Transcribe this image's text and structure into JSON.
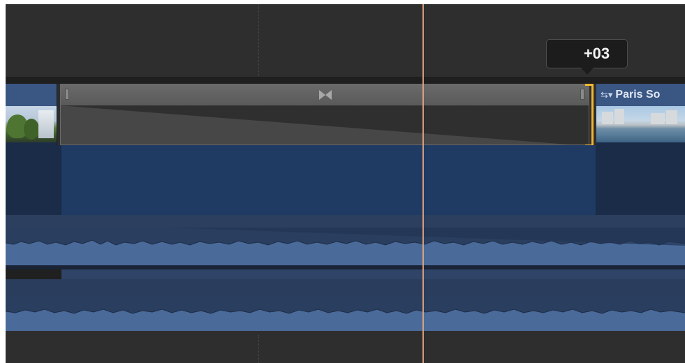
{
  "tooltip": {
    "offset_value": "+03"
  },
  "clips": {
    "right_clip_title": "Paris So",
    "right_clip_icon": "connected-clip-icon"
  },
  "icons": {
    "transition": "bowtie-transition-icon",
    "clip_menu": "swap-arrows-dropdown-icon"
  },
  "colors": {
    "timeline_bg": "#2e2e2e",
    "clip_header": "#3a5683",
    "clip_body": "#1b2c49",
    "audio_wave": "#4a6a9a",
    "trim_highlight": "#f2b630",
    "playhead": "#e6a77f",
    "tooltip_bg": "#1c1c1c"
  }
}
